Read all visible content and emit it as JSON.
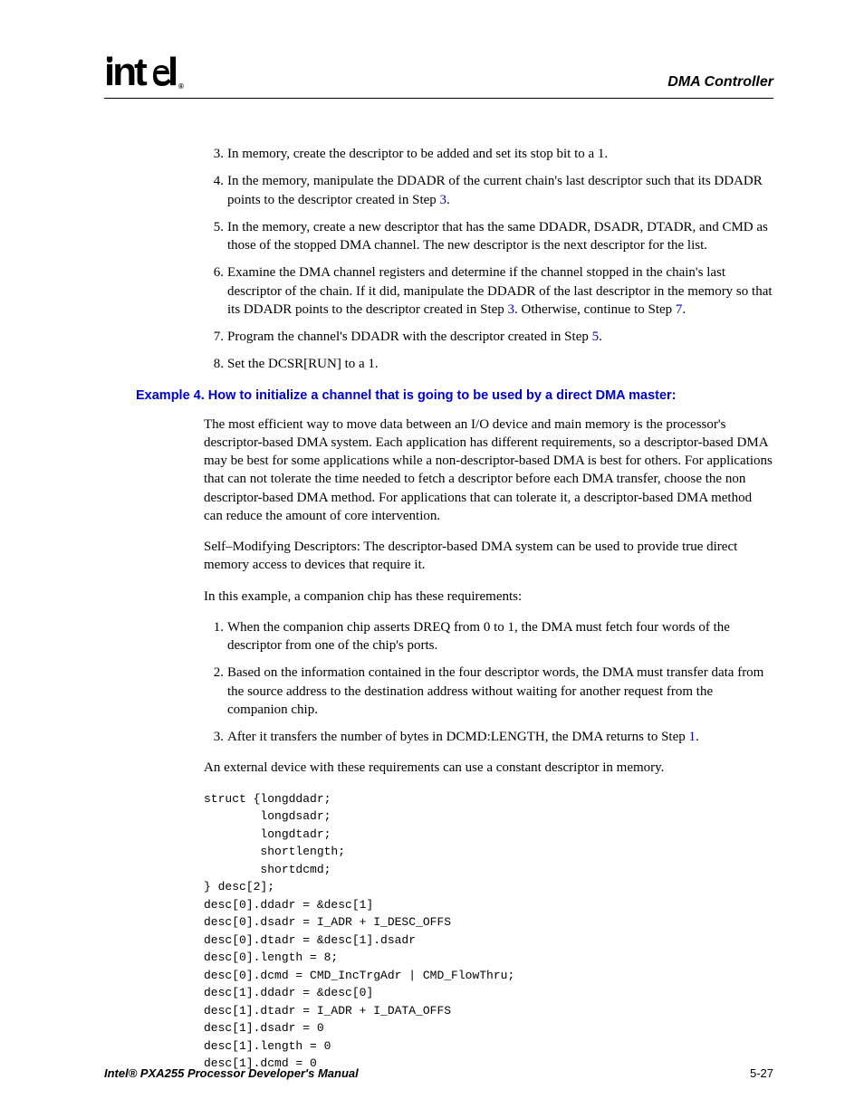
{
  "header": {
    "logo_text": "intel",
    "section_title": "DMA Controller"
  },
  "list1": {
    "i3": {
      "n": "3.",
      "t": "In memory, create the descriptor to be added and set its stop bit to a 1."
    },
    "i4": {
      "n": "4.",
      "t_a": "In the memory, manipulate the DDADR of the current chain's last descriptor such that its DDADR points to the descriptor created in Step ",
      "link": "3",
      "t_b": "."
    },
    "i5": {
      "n": "5.",
      "t": "In the memory, create a new descriptor that has the same DDADR, DSADR, DTADR, and CMD as those of the stopped DMA channel. The new descriptor is the next descriptor for the list."
    },
    "i6": {
      "n": "6.",
      "t_a": "Examine the DMA channel registers and determine if the channel stopped in the chain's last descriptor of the chain. If it did, manipulate the DDADR of the last descriptor in the memory so that its DDADR points to the descriptor created in Step ",
      "link1": "3",
      "t_b": ". Otherwise, continue to Step ",
      "link2": "7",
      "t_c": "."
    },
    "i7": {
      "n": "7.",
      "t_a": "Program the channel's DDADR with the descriptor created in Step ",
      "link": "5",
      "t_b": "."
    },
    "i8": {
      "n": "8.",
      "t": "Set the DCSR[RUN] to a 1."
    }
  },
  "example": {
    "heading": "Example 4. How to initialize a channel that is going to be used by a direct DMA master:",
    "p1": "The most efficient way to move data between an I/O device and main memory is the processor's descriptor-based DMA system. Each application has different requirements, so a descriptor-based DMA may be best for some applications while a non-descriptor-based DMA is best for others. For applications that can not tolerate the time needed to fetch a descriptor before each DMA transfer, choose the non descriptor-based DMA method. For applications that can tolerate it, a descriptor-based DMA method can reduce the amount of core intervention.",
    "p2": "Self–Modifying Descriptors: The descriptor-based DMA system can be used to provide true direct memory access to devices that require it.",
    "p3": "In this example, a companion chip has these requirements:",
    "list": {
      "i1": {
        "n": "1.",
        "t": "When the companion chip asserts DREQ from 0 to 1, the DMA must fetch four words of the descriptor from one of the chip's ports."
      },
      "i2": {
        "n": "2.",
        "t": "Based on the information contained in the four descriptor words, the DMA must transfer data from the source address to the destination address without waiting for another request from the companion chip."
      },
      "i3": {
        "n": "3.",
        "t_a": "After it transfers the number of bytes in DCMD:LENGTH, the DMA returns to Step ",
        "link": "1",
        "t_b": "."
      }
    },
    "p4": "An external device with these requirements can use a constant descriptor in memory.",
    "code": "struct {longddadr;\n        longdsadr;\n        longdtadr;\n        shortlength;\n        shortdcmd;\n} desc[2];\ndesc[0].ddadr = &desc[1]\ndesc[0].dsadr = I_ADR + I_DESC_OFFS\ndesc[0].dtadr = &desc[1].dsadr\ndesc[0].length = 8;\ndesc[0].dcmd = CMD_IncTrgAdr | CMD_FlowThru;\ndesc[1].ddadr = &desc[0]\ndesc[1].dtadr = I_ADR + I_DATA_OFFS\ndesc[1].dsadr = 0\ndesc[1].length = 0\ndesc[1].dcmd = 0"
  },
  "footer": {
    "left": "Intel® PXA255 Processor Developer's Manual",
    "right": "5-27"
  }
}
